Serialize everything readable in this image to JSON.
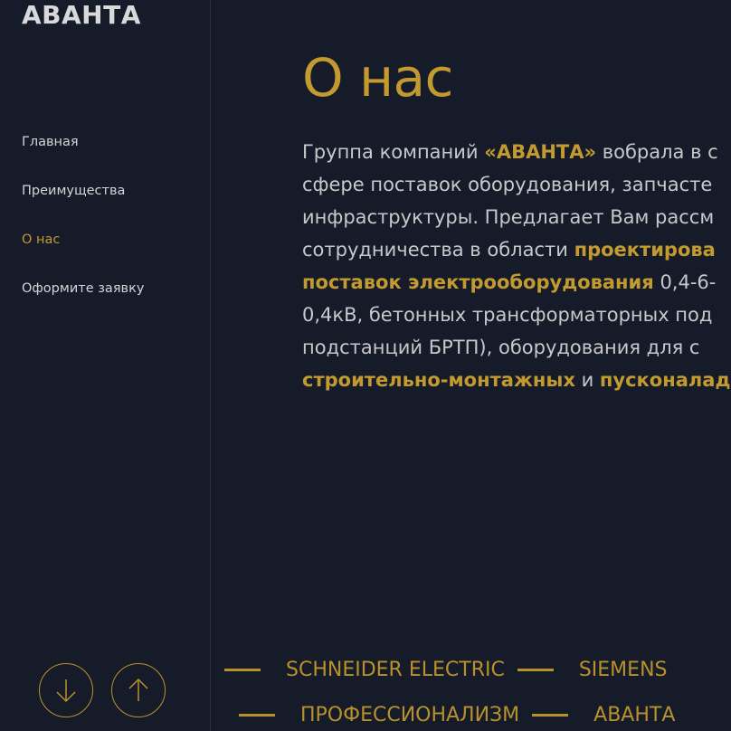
{
  "logo": "АВАНТА",
  "nav": {
    "items": [
      {
        "label": "Главная"
      },
      {
        "label": "Преимущества"
      },
      {
        "label": "О нас"
      },
      {
        "label": "Оформите заявку"
      }
    ],
    "active_index": 2
  },
  "controls": {
    "down_icon": "arrow-down-icon",
    "up_icon": "arrow-up-icon"
  },
  "about": {
    "title": "О нас",
    "lines": [
      {
        "a": "Группа компаний ",
        "b": "«АВАНТА»",
        "c": " вобрала в с"
      },
      {
        "a": "сфере поставок оборудования, запчасте",
        "b": "",
        "c": ""
      },
      {
        "a": "инфраструктуры. Предлагает Вам рассм",
        "b": "",
        "c": ""
      },
      {
        "a": "сотрудничества в области ",
        "b": "проектирова",
        "c": ""
      },
      {
        "a": "",
        "b": "поставок электрооборудования",
        "c": " 0,4-6-"
      },
      {
        "a": "0,4кВ, бетонных трансформаторных под",
        "b": "",
        "c": ""
      },
      {
        "a": "подстанций БРТП), оборудования для с",
        "b": "",
        "c": ""
      },
      {
        "a": "",
        "b": "строительно-монтажных",
        "c": " и ",
        "d": "пусконалад"
      }
    ]
  },
  "ticker": {
    "row1": [
      "SCHNEIDER ELECTRIC",
      "SIEMENS"
    ],
    "row2": [
      "ПРОФЕССИОНАЛИЗМ",
      "АВАНТА"
    ]
  },
  "colors": {
    "background": "#161b29",
    "accent": "#c29a2f",
    "text": "#c8c8cc"
  }
}
